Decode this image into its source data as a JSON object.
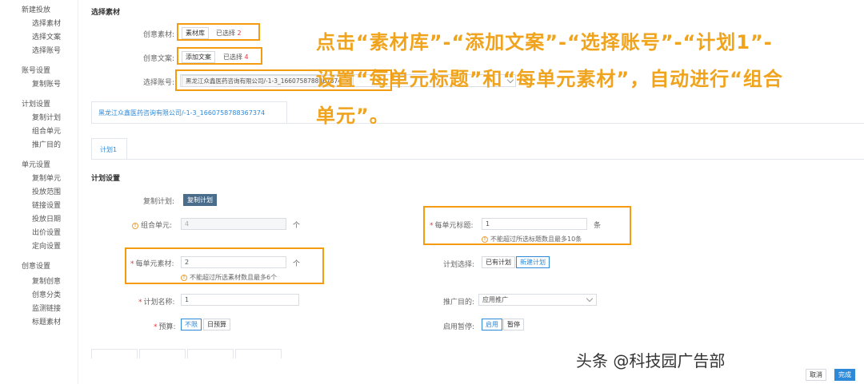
{
  "sidebar": {
    "groups": [
      {
        "label": "新建投放",
        "items": [
          "选择素材",
          "选择文案",
          "选择账号"
        ]
      },
      {
        "label": "账号设置",
        "items": [
          "复制账号"
        ]
      },
      {
        "label": "计划设置",
        "items": [
          "复制计划",
          "组合单元",
          "推广目的"
        ]
      },
      {
        "label": "单元设置",
        "items": [
          "复制单元",
          "投放范围",
          "链接设置",
          "投放日期",
          "出价设置",
          "定向设置"
        ]
      },
      {
        "label": "创意设置",
        "items": [
          "复制创意",
          "创意分类",
          "监测链接",
          "标题素材"
        ]
      }
    ]
  },
  "select_material": {
    "title": "选择素材",
    "creative_material_label": "创意素材:",
    "creative_material_button": "素材库",
    "creative_material_selected_prefix": "已选择",
    "creative_material_count": "2",
    "creative_copy_label": "创意文案:",
    "creative_copy_button": "添加文案",
    "creative_copy_selected_prefix": "已选择",
    "creative_copy_count": "4",
    "account_label": "选择账号:",
    "account_tag": "黑龙江众鑫医药咨询有限公司/-1-3_1660758788367374",
    "account_tag_close": "×"
  },
  "account_tab": "黑龙江众鑫医药咨询有限公司/-1-3_1660758788367374",
  "plan_tab": "计划1",
  "plan_settings": {
    "title": "计划设置",
    "copy_plan_label": "复制计划:",
    "copy_plan_button": "复制计划",
    "combine_unit_label": "组合单元:",
    "combine_unit_value": "4",
    "combine_unit_unit": "个",
    "unit_title_label": "每单元标题:",
    "unit_title_value": "1",
    "unit_title_unit": "条",
    "unit_title_hint": "不能超过所选标题数且最多10条",
    "unit_material_label": "每单元素材:",
    "unit_material_value": "2",
    "unit_material_unit": "个",
    "unit_material_hint": "不能超过所选素材数且最多6个",
    "plan_select_label": "计划选择:",
    "plan_select_options": [
      "已有计划",
      "新建计划"
    ],
    "plan_name_label": "计划名称:",
    "plan_name_value": "1",
    "promo_goal_label": "推广目的:",
    "promo_goal_value": "应用推广",
    "budget_label": "预算:",
    "budget_options": [
      "不限",
      "日预算"
    ],
    "pause_label": "启用暂停:",
    "pause_options": [
      "启用",
      "暂停"
    ]
  },
  "footer": {
    "cancel": "取消",
    "done": "完成"
  },
  "annotation": "点击“素材库”-“添加文案”-“选择账号”-“计划1”-设置“每单元标题”和“每单元素材”，自动进行“组合单元”。",
  "watermark": "头条 @科技园广告部",
  "colors": {
    "accent": "#2e8ad8",
    "primary_button": "#4a6d8c",
    "highlight_box": "#f39c12",
    "count": "#e4393c"
  }
}
